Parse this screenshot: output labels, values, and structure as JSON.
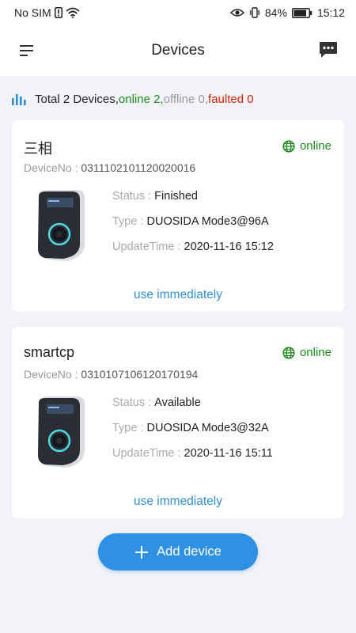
{
  "statusbar": {
    "carrier": "No SIM",
    "battery": "84%",
    "time": "15:12",
    "icons": [
      "sim-alert-icon",
      "wifi-icon",
      "eye-icon",
      "vibrate-icon",
      "battery-icon"
    ]
  },
  "header": {
    "title": "Devices",
    "left_icon": "menu-icon",
    "right_icon": "chat-icon"
  },
  "summary": {
    "total": "Total 2 Devices,",
    "online": "online 2,",
    "offline": "offline 0,",
    "faulted": "faulted 0"
  },
  "labels": {
    "device_no": "DeviceNo :",
    "status": "Status :",
    "type": "Type :",
    "update_time": "UpdateTime :"
  },
  "devices": [
    {
      "name": "三相",
      "online_status": "online",
      "device_no": "0311102101120020016",
      "status": "Finished",
      "type": "DUOSIDA Mode3@96A",
      "update_time": "2020-11-16 15:12",
      "action": "use immediately"
    },
    {
      "name": "smartcp",
      "online_status": "online",
      "device_no": "0310107106120170194",
      "status": "Available",
      "type": "DUOSIDA Mode3@32A",
      "update_time": "2020-11-16 15:11",
      "action": "use immediately"
    }
  ],
  "add_button": {
    "label": "Add device",
    "icon": "plus-icon"
  },
  "colors": {
    "online": "#1d8a1d",
    "offline": "#999999",
    "faulted": "#d81e06",
    "accent": "#2e91e3",
    "link": "#2f8fd0"
  }
}
